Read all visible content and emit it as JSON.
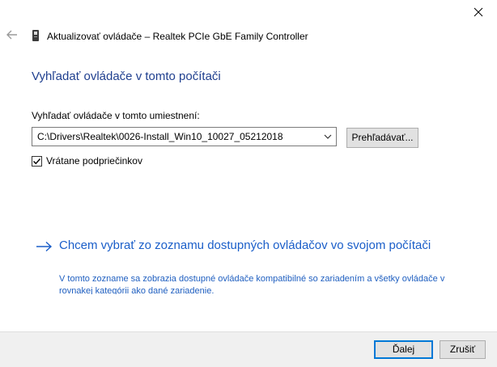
{
  "wizard": {
    "title": "Aktualizovať ovládače – Realtek PCIe GbE Family Controller",
    "back_icon": "back-arrow-icon",
    "close_icon": "close-icon"
  },
  "main": {
    "heading": "Vyhľadať ovládače v tomto počítači",
    "location_label": "Vyhľadať ovládače v tomto umiestnení:",
    "location_value": "C:\\Drivers\\Realtek\\0026-Install_Win10_10027_05212018",
    "browse_label": "Prehľadávať...",
    "include_subfolders": {
      "label": "Vrátane podpriečinkov",
      "checked": true
    },
    "pick_link": {
      "title": "Chcem vybrať zo zoznamu dostupných ovládačov vo svojom počítači",
      "description": "V tomto zozname sa zobrazia dostupné ovládače kompatibilné so zariadením a všetky ovládače v rovnakej kategórii ako dané zariadenie."
    }
  },
  "footer": {
    "next_label": "Ďalej",
    "cancel_label": "Zrušiť"
  },
  "colors": {
    "heading": "#1f3f8f",
    "link": "#1a5ec9",
    "default_button_border": "#0078d7"
  }
}
